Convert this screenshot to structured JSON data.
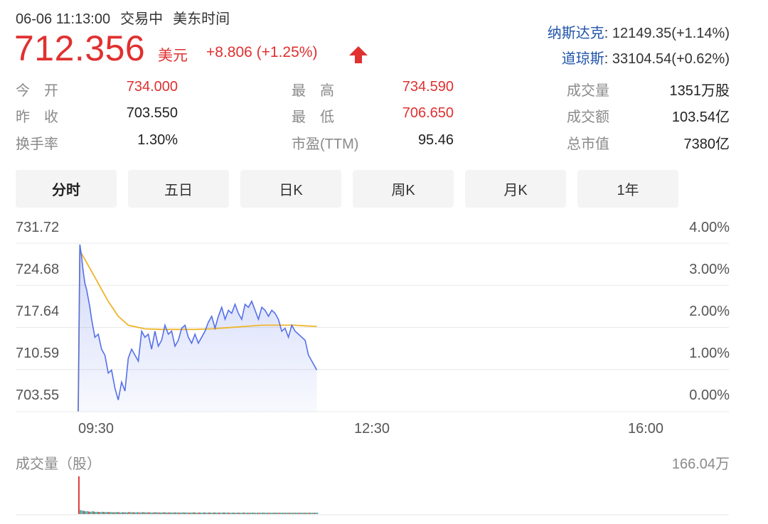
{
  "header": {
    "date_time": "06-06 11:13:00",
    "trading_status": "交易中",
    "timezone": "美东时间",
    "price": "712.356",
    "currency": "美元",
    "change": "+8.806 (+1.25%)"
  },
  "indices": [
    {
      "name": "纳斯达克",
      "value": ": 12149.35(+1.14%)"
    },
    {
      "name": "道琼斯",
      "value": ": 33104.54(+0.62%)"
    }
  ],
  "stats": {
    "open_label": "今　开",
    "open": "734.000",
    "high_label": "最　高",
    "high": "734.590",
    "volume_label": "成交量",
    "volume": "1351万股",
    "prev_close_label": "昨　收",
    "prev_close": "703.550",
    "low_label": "最　低",
    "low": "706.650",
    "turnover_label": "成交额",
    "turnover": "103.54亿",
    "turnover_rate_label": "换手率",
    "turnover_rate": "1.30%",
    "pe_label": "市盈(TTM)",
    "pe": "95.46",
    "mktcap_label": "总市值",
    "mktcap": "7380亿"
  },
  "tabs": [
    "分时",
    "五日",
    "日K",
    "周K",
    "月K",
    "1年"
  ],
  "colors": {
    "up": "#e03030",
    "price_line": "#5470e8",
    "avg_line": "#f0b429",
    "index_name": "#2255aa",
    "volume_up": "#e03030",
    "volume_down": "#26a69a"
  },
  "chart_data": {
    "type": "line",
    "y_left_ticks": [
      "731.72",
      "724.68",
      "717.64",
      "710.59",
      "703.55"
    ],
    "y_right_ticks": [
      "4.00%",
      "3.00%",
      "2.00%",
      "1.00%",
      "0.00%"
    ],
    "x_ticks": [
      "09:30",
      "12:30",
      "16:00"
    ],
    "ylim": [
      703.55,
      731.72
    ],
    "x_range_minutes": [
      0,
      390
    ],
    "volume_label": "成交量（股）",
    "volume_max_label": "166.04万",
    "series": [
      {
        "key": "price",
        "x": [
          0,
          1,
          2,
          3,
          4,
          5,
          6,
          7,
          8,
          9,
          10,
          12,
          14,
          16,
          18,
          20,
          22,
          24,
          26,
          28,
          30,
          32,
          34,
          36,
          38,
          40,
          42,
          44,
          46,
          48,
          50,
          52,
          54,
          56,
          58,
          60,
          62,
          64,
          66,
          68,
          70,
          72,
          74,
          76,
          78,
          80,
          82,
          84,
          86,
          88,
          90,
          92,
          94,
          96,
          98,
          100,
          102,
          104,
          106,
          108,
          110,
          112,
          114,
          116,
          118,
          120,
          122,
          124,
          126,
          128,
          130,
          132,
          134,
          136,
          138,
          140,
          142,
          143
        ],
        "y": [
          703.6,
          731.5,
          729.5,
          727.0,
          725.0,
          724.0,
          722.5,
          721.0,
          719.0,
          717.5,
          716.0,
          716.5,
          714.0,
          713.0,
          710.0,
          710.5,
          707.5,
          705.5,
          708.5,
          707.0,
          712.5,
          714.0,
          713.0,
          712.0,
          717.0,
          716.0,
          716.5,
          714.0,
          717.0,
          714.5,
          715.5,
          718.0,
          716.5,
          717.0,
          714.5,
          715.5,
          717.5,
          718.0,
          716.0,
          715.0,
          716.5,
          715.0,
          716.0,
          717.0,
          718.5,
          719.5,
          717.5,
          719.5,
          721.0,
          719.0,
          720.5,
          720.0,
          721.5,
          720.0,
          719.0,
          721.5,
          721.0,
          722.0,
          720.5,
          719.0,
          721.0,
          720.5,
          719.5,
          720.5,
          720.0,
          719.0,
          717.0,
          717.5,
          716.0,
          718.0,
          717.0,
          716.5,
          716.0,
          715.5,
          713.0,
          712.0,
          711.0,
          710.5
        ]
      },
      {
        "key": "average",
        "x": [
          0,
          1,
          3,
          6,
          10,
          14,
          18,
          24,
          30,
          40,
          50,
          60,
          70,
          80,
          90,
          100,
          110,
          120,
          130,
          136,
          143
        ],
        "y": [
          703.6,
          730.5,
          729.5,
          728.0,
          726.0,
          724.0,
          722.0,
          719.5,
          718.0,
          717.4,
          717.3,
          717.3,
          717.3,
          717.4,
          717.6,
          717.8,
          718.0,
          718.0,
          718.0,
          717.9,
          717.8
        ]
      }
    ],
    "volume": {
      "x": [
        0,
        1,
        2,
        3,
        4,
        5,
        6,
        7,
        8,
        9,
        10,
        11,
        12,
        13,
        14,
        15,
        16,
        17,
        18,
        19,
        20,
        21,
        22,
        23,
        24,
        25,
        26,
        27,
        28,
        29,
        30,
        31,
        32,
        33,
        34,
        35,
        36,
        37,
        38,
        39,
        40,
        41,
        42,
        43,
        44,
        45,
        46,
        47,
        48,
        49,
        50,
        51,
        52,
        53,
        54,
        55,
        56,
        57,
        58,
        59,
        60,
        61,
        62,
        63,
        64,
        65,
        66,
        67,
        68,
        69,
        70,
        71,
        72,
        73,
        74,
        75,
        76,
        77,
        78,
        79,
        80,
        81,
        82,
        83,
        84,
        85,
        86,
        87,
        88,
        89,
        90,
        91,
        92,
        93,
        94,
        95,
        96,
        97,
        98,
        99,
        100,
        101,
        102,
        103,
        104,
        105,
        106,
        107,
        108,
        109,
        110,
        111,
        112,
        113,
        114,
        115,
        116,
        117,
        118,
        119,
        120,
        121,
        122,
        123,
        124,
        125,
        126,
        127,
        128,
        129,
        130,
        131,
        132,
        133,
        134,
        135,
        136,
        137,
        138,
        139,
        140,
        141,
        142,
        143
      ],
      "values": [
        1660400,
        180000,
        150000,
        140000,
        120000,
        130000,
        110000,
        100000,
        120000,
        110000,
        90000,
        100000,
        95000,
        85000,
        100000,
        90000,
        80000,
        95000,
        85000,
        90000,
        80000,
        75000,
        85000,
        90000,
        80000,
        70000,
        85000,
        75000,
        80000,
        70000,
        90000,
        80000,
        75000,
        85000,
        70000,
        80000,
        75000,
        70000,
        85000,
        80000,
        70000,
        75000,
        80000,
        70000,
        65000,
        75000,
        80000,
        70000,
        75000,
        65000,
        70000,
        80000,
        70000,
        65000,
        75000,
        70000,
        65000,
        70000,
        75000,
        65000,
        70000,
        60000,
        75000,
        70000,
        65000,
        70000,
        60000,
        65000,
        70000,
        75000,
        65000,
        60000,
        70000,
        65000,
        60000,
        70000,
        65000,
        60000,
        65000,
        70000,
        60000,
        65000,
        70000,
        60000,
        65000,
        60000,
        65000,
        70000,
        60000,
        65000,
        60000,
        55000,
        65000,
        60000,
        55000,
        65000,
        60000,
        55000,
        60000,
        65000,
        55000,
        60000,
        55000,
        60000,
        65000,
        55000,
        60000,
        55000,
        60000,
        55000,
        65000,
        60000,
        55000,
        60000,
        55000,
        60000,
        55000,
        60000,
        65000,
        55000,
        60000,
        55000,
        60000,
        55000,
        60000,
        55000,
        60000,
        55000,
        60000,
        55000,
        60000,
        55000,
        60000,
        55000,
        60000,
        55000,
        60000,
        55000,
        60000,
        55000,
        60000,
        55000,
        60000,
        55000
      ]
    }
  }
}
